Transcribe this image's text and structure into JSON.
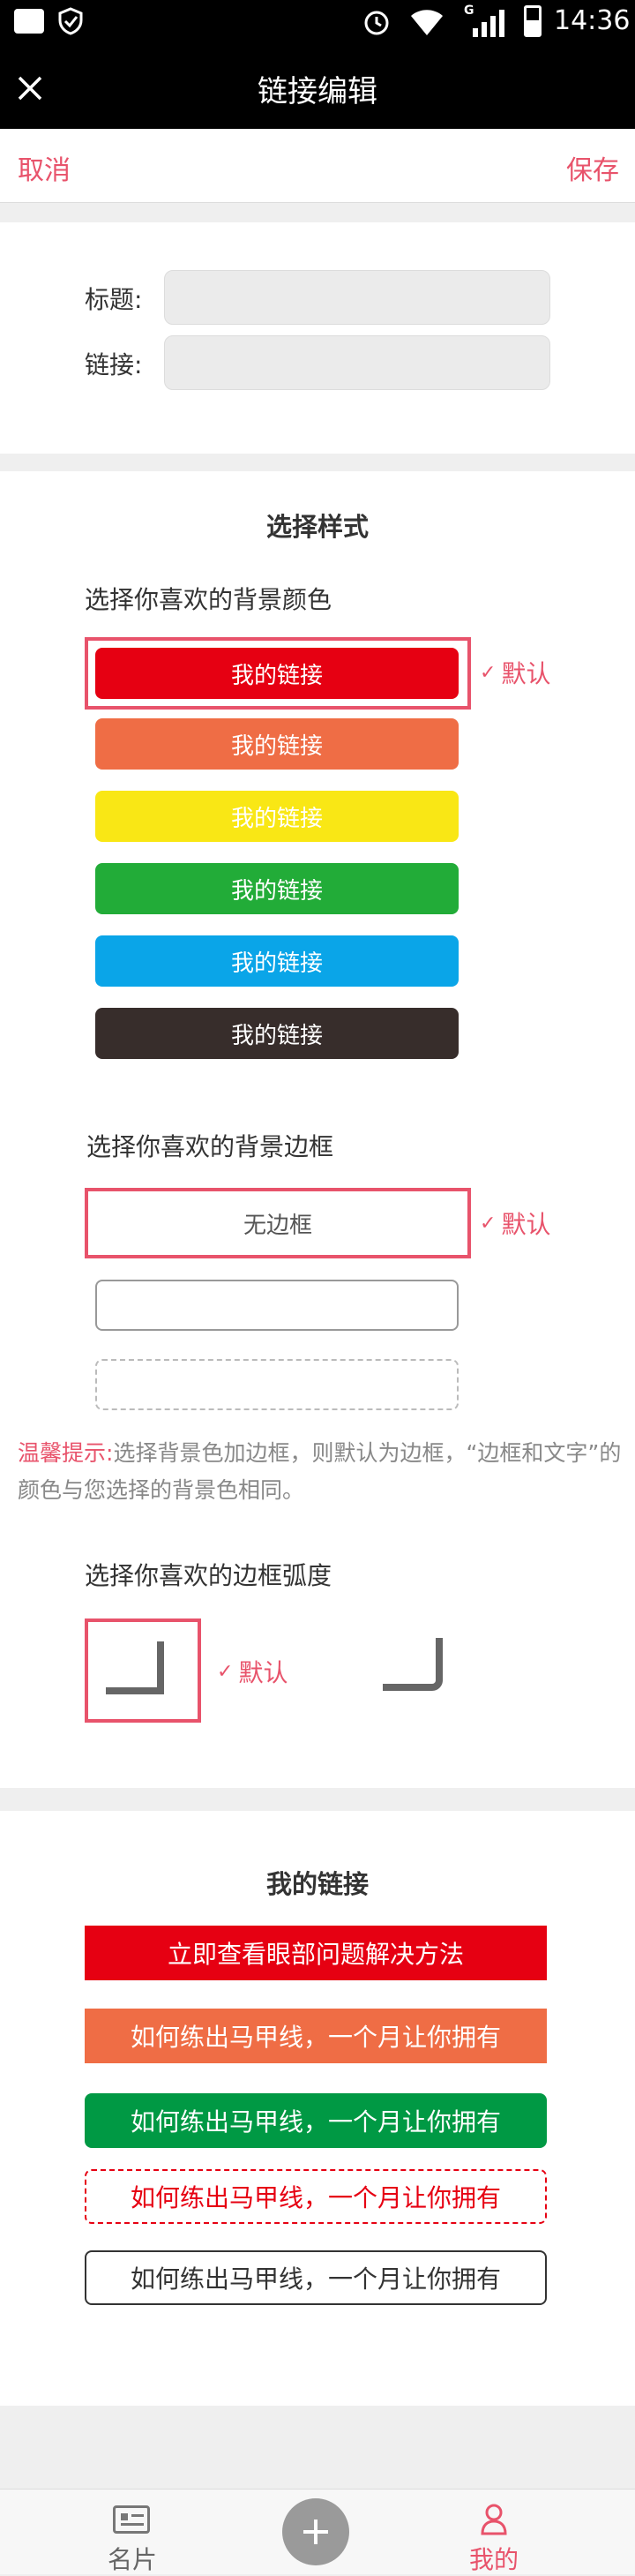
{
  "status": {
    "time": "14:36",
    "network": "G"
  },
  "header": {
    "title": "链接编辑"
  },
  "topbar": {
    "cancel": "取消",
    "save": "保存"
  },
  "form": {
    "title_label": "标题:",
    "link_label": "链接:",
    "title_value": "",
    "link_value": ""
  },
  "style": {
    "heading": "选择样式",
    "bg_heading": "选择你喜欢的背景颜色",
    "button_text": "我的链接",
    "default_label": "默认",
    "bg_colors": [
      "#e60012",
      "#ef6d45",
      "#f9e715",
      "#22ac38",
      "#0aa5e8",
      "#372d2b"
    ],
    "border_heading": "选择你喜欢的背景边框",
    "no_border": "无边框",
    "tip_label": "温馨提示:",
    "tip_text": "选择背景色加边框，则默认为边框，“边框和文字”的颜色与您选择的背景色相同。",
    "radius_heading": "选择你喜欢的边框弧度"
  },
  "links": {
    "heading": "我的链接",
    "items": [
      "立即查看眼部问题解决方法",
      "如何练出马甲线，一个月让你拥有",
      "如何练出马甲线，一个月让你拥有",
      "如何练出马甲线，一个月让你拥有",
      "如何练出马甲线，一个月让你拥有"
    ]
  },
  "tabs": {
    "card": "名片",
    "mine": "我的"
  },
  "colors": {
    "accent": "#e8536b",
    "status_bg": "#000000"
  }
}
